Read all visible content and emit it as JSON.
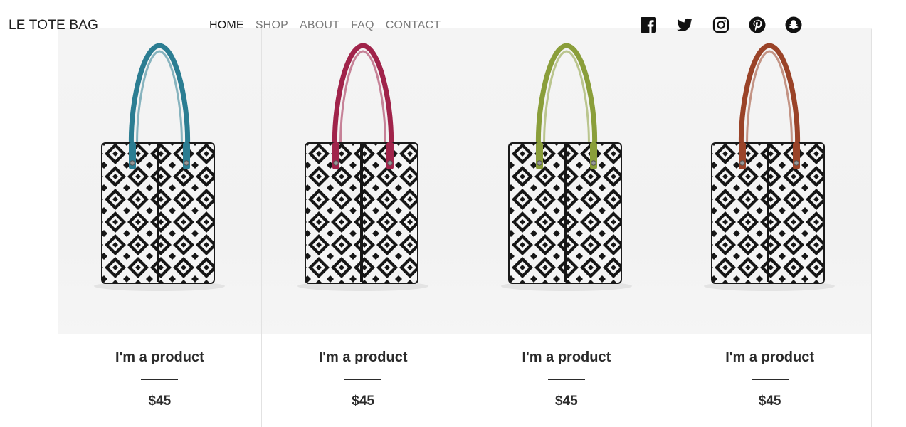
{
  "brand": "LE TOTE BAG",
  "nav": [
    {
      "label": "HOME",
      "active": true
    },
    {
      "label": "SHOP",
      "active": false
    },
    {
      "label": "ABOUT",
      "active": false
    },
    {
      "label": "FAQ",
      "active": false
    },
    {
      "label": "CONTACT",
      "active": false
    }
  ],
  "social": [
    {
      "icon": "facebook-icon"
    },
    {
      "icon": "twitter-icon"
    },
    {
      "icon": "instagram-icon"
    },
    {
      "icon": "pinterest-icon"
    },
    {
      "icon": "snapchat-icon"
    }
  ],
  "products": [
    {
      "name": "I'm a product",
      "price": "$45",
      "strap_color": "#2b7d92"
    },
    {
      "name": "I'm a product",
      "price": "$45",
      "strap_color": "#a0234a"
    },
    {
      "name": "I'm a product",
      "price": "$45",
      "strap_color": "#8a9e3a"
    },
    {
      "name": "I'm a product",
      "price": "$45",
      "strap_color": "#9a4328"
    }
  ]
}
